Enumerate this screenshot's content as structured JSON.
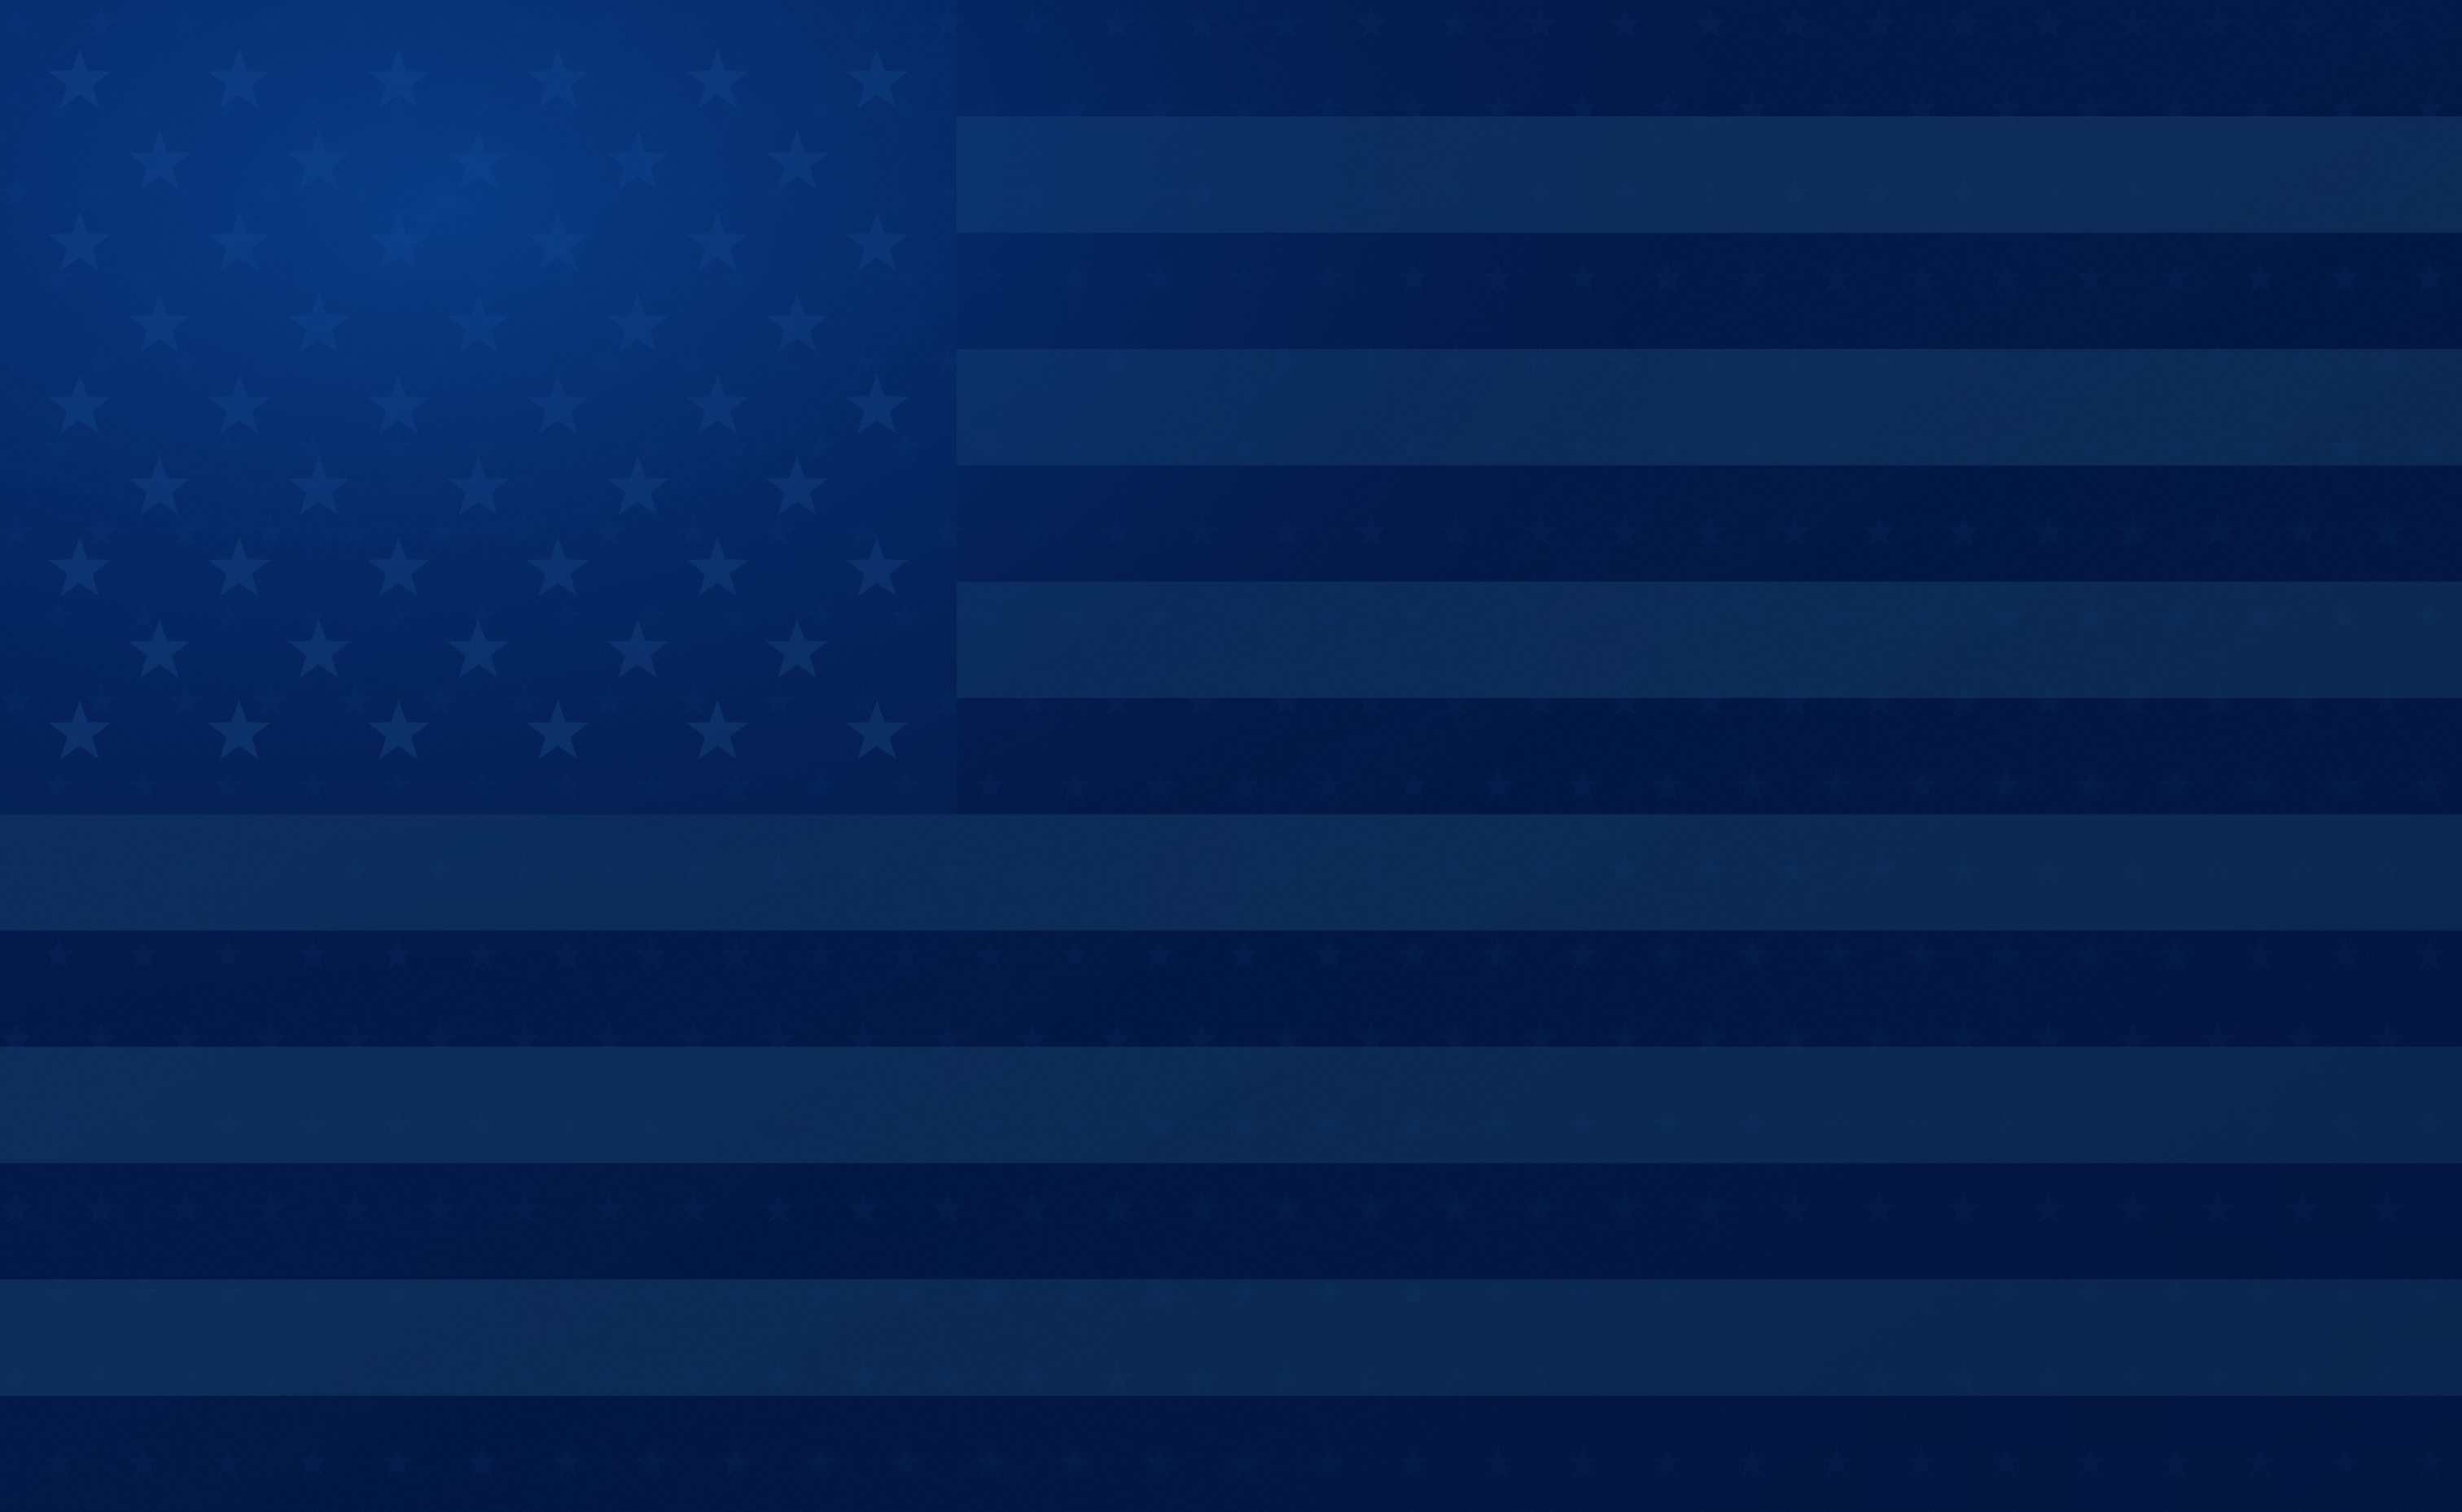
{
  "desktop": {
    "wallpaper": {
      "subject": "tonal-blue-us-flag",
      "colors": {
        "base": "#03215a",
        "base_dark": "#021a4a",
        "canton_glow": "#0a3f8f",
        "stripe_light": "#0f3566",
        "star": "#1a4a86",
        "vignette": "#01122f"
      },
      "stripe_count": 13,
      "canton_stripe_span": 7,
      "star_rows": 9,
      "star_cols_long": 6,
      "star_cols_short": 5,
      "grain": true
    }
  }
}
